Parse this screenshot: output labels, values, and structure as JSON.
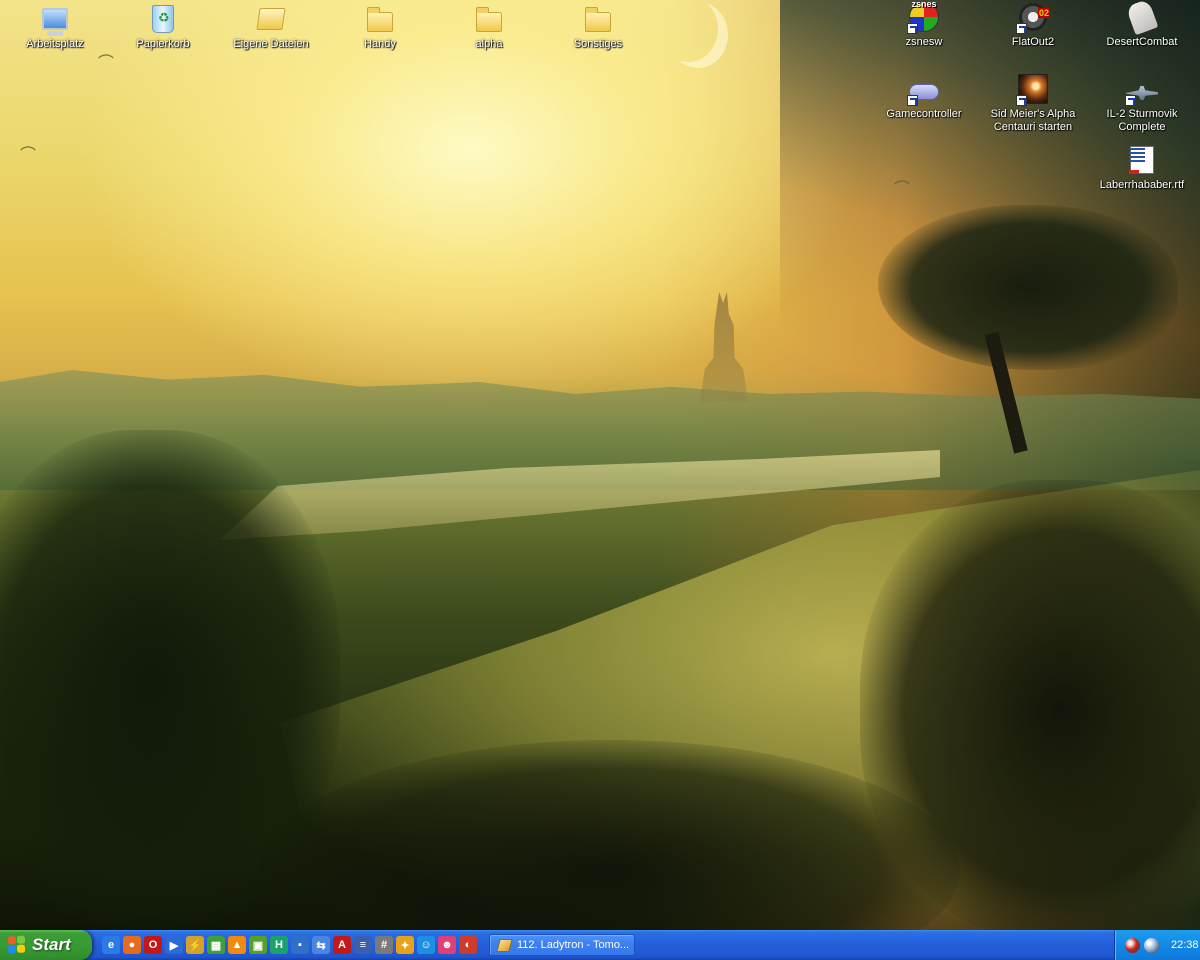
{
  "desktop": {
    "icons_left": [
      {
        "label": "Arbeitsplatz",
        "icon": "my-computer-icon"
      },
      {
        "label": "Papierkorb",
        "icon": "recycle-bin-icon"
      },
      {
        "label": "Eigene Dateien",
        "icon": "my-documents-icon"
      },
      {
        "label": "Handy",
        "icon": "folder-icon"
      },
      {
        "label": "alpha",
        "icon": "folder-icon"
      },
      {
        "label": "Sonstiges",
        "icon": "folder-icon"
      }
    ],
    "icons_right": [
      {
        "label": "zsnesw",
        "icon": "zsnes-icon",
        "badge": "zsnes"
      },
      {
        "label": "FlatOut2",
        "icon": "flatout2-icon",
        "badge": "02"
      },
      {
        "label": "DesertCombat",
        "icon": "desertcombat-icon"
      },
      {
        "label": "Gamecontroller",
        "icon": "gamepad-icon"
      },
      {
        "label": "Sid Meier's Alpha Centauri starten",
        "icon": "alpha-centauri-icon"
      },
      {
        "label": "IL-2 Sturmovik Complete",
        "icon": "airplane-icon"
      },
      {
        "label": "Laberrhababer.rtf",
        "icon": "rtf-document-icon"
      }
    ]
  },
  "taskbar": {
    "start_label": "Start",
    "quick_launch": [
      {
        "icon": "internet-explorer-icon",
        "glyph": "e",
        "color": "#2b7be6"
      },
      {
        "icon": "firefox-icon",
        "glyph": "●",
        "color": "#e66b1f"
      },
      {
        "icon": "opera-icon",
        "glyph": "O",
        "color": "#c41818"
      },
      {
        "icon": "media-player-icon",
        "glyph": "▶",
        "color": "#2d6ad8"
      },
      {
        "icon": "winamp-icon",
        "glyph": "⚡",
        "color": "#d4a12a"
      },
      {
        "icon": "image-editor-icon",
        "glyph": "▦",
        "color": "#3f9f3a"
      },
      {
        "icon": "vlc-icon",
        "glyph": "▲",
        "color": "#f08a10"
      },
      {
        "icon": "picture-viewer-icon",
        "glyph": "▣",
        "color": "#55a02a"
      },
      {
        "icon": "app-h-icon",
        "glyph": "H",
        "color": "#1aa36b"
      },
      {
        "icon": "network-icon",
        "glyph": "▪",
        "color": "#2f6fc8"
      },
      {
        "icon": "file-transfer-icon",
        "glyph": "⇆",
        "color": "#4a86e0"
      },
      {
        "icon": "acrobat-icon",
        "glyph": "A",
        "color": "#c21a1a"
      },
      {
        "icon": "text-editor-icon",
        "glyph": "≡",
        "color": "#3a5fb0"
      },
      {
        "icon": "calculator-icon",
        "glyph": "#",
        "color": "#7a7a7a"
      },
      {
        "icon": "settings-gear-icon",
        "glyph": "✦",
        "color": "#e6a21a"
      },
      {
        "icon": "messenger-icon",
        "glyph": "☺",
        "color": "#1e90e0"
      },
      {
        "icon": "chat-icon",
        "glyph": "☻",
        "color": "#e0407a"
      },
      {
        "icon": "tool-icon",
        "glyph": "◐",
        "color": "#d03a2a"
      }
    ],
    "tasks": [
      {
        "label": "112. Ladytron - Tomo..."
      }
    ],
    "tray": {
      "icons": [
        {
          "icon": "tray-app-red-icon",
          "color": "#c72a1a"
        },
        {
          "icon": "tray-speaker-icon",
          "color": "#9ab6d8"
        }
      ],
      "clock": "22:38"
    }
  }
}
